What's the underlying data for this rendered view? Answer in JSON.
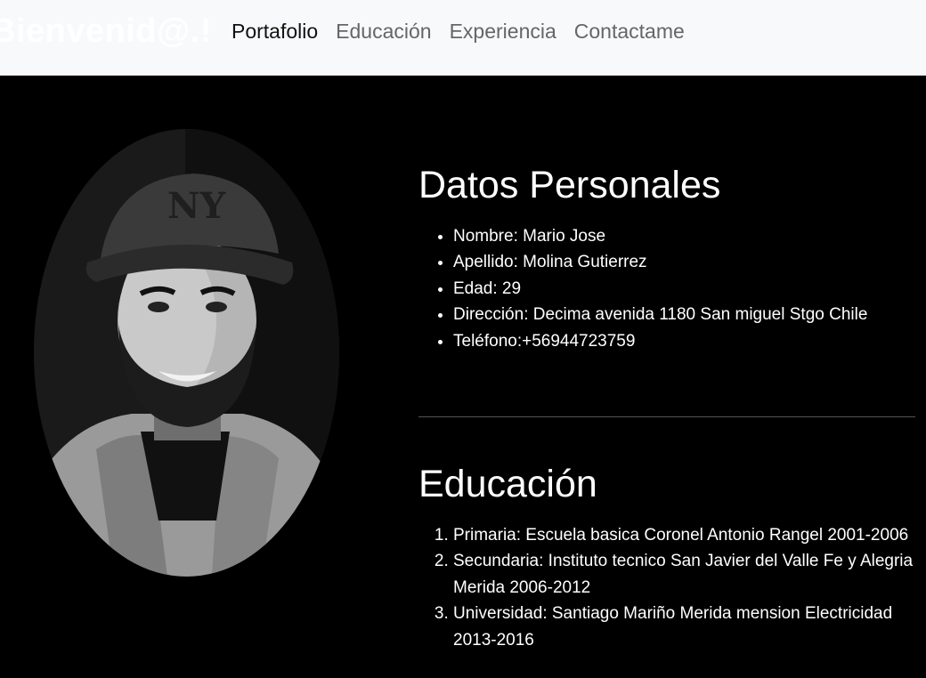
{
  "navbar": {
    "brand": "Bienvenid@.!",
    "links": [
      {
        "label": "Portafolio",
        "active": true
      },
      {
        "label": "Educación",
        "active": false
      },
      {
        "label": "Experiencia",
        "active": false
      },
      {
        "label": "Contactame",
        "active": false
      }
    ]
  },
  "profile": {
    "photo_alt": "portrait-photo"
  },
  "personal": {
    "title": "Datos Personales",
    "items": [
      "Nombre: Mario Jose",
      "Apellido: Molina Gutierrez",
      "Edad: 29",
      "Dirección: Decima avenida 1180 San miguel Stgo Chile",
      "Teléfono:+56944723759"
    ]
  },
  "education": {
    "title": "Educación",
    "items": [
      "Primaria: Escuela basica Coronel Antonio Rangel 2001-2006",
      "Secundaria: Instituto tecnico San Javier del Valle Fe y Alegria Merida 2006-2012",
      "Universidad: Santiago Mariño Merida mension Electricidad 2013-2016"
    ]
  },
  "colors": {
    "navbar_bg": "#f8f9fa",
    "page_bg": "#000000",
    "text": "#ffffff",
    "nav_active": "#111111",
    "nav_inactive": "#666666"
  }
}
